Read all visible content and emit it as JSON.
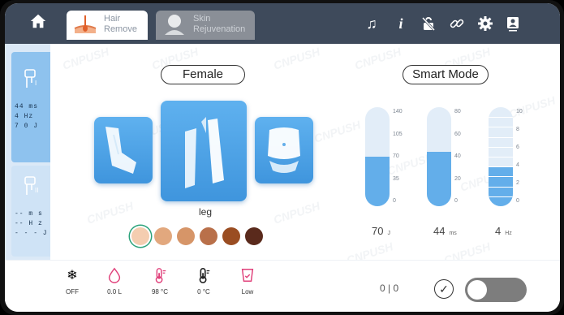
{
  "tabs": [
    {
      "label": "Hair Remove",
      "line1": "Hair",
      "line2": "Remove",
      "active": true
    },
    {
      "label": "Skin Rejuvenation",
      "line1": "Skin",
      "line2": "Rejuvenation",
      "active": false
    }
  ],
  "toolbar_icons": [
    "home-icon",
    "music-icon",
    "info-icon",
    "lock-off-icon",
    "link-icon",
    "gear-icon",
    "user-card-icon"
  ],
  "handpieces": [
    {
      "id": "I",
      "label": "I",
      "line1": "44 ms",
      "line2": "4  Hz",
      "line3": "7 0  J"
    },
    {
      "id": "II",
      "label": "II",
      "line1": "-- m s",
      "line2": "-- H z",
      "line3": "- - -  J"
    }
  ],
  "gender_label": "Female",
  "mode_label": "Smart Mode",
  "body_zones": [
    {
      "name": "arm",
      "selected": false
    },
    {
      "name": "leg",
      "selected": true
    },
    {
      "name": "abdomen",
      "selected": false
    }
  ],
  "selected_zone_label": "leg",
  "skin_tones": {
    "colors": [
      "#f4cdb0",
      "#e2a87e",
      "#d69568",
      "#b9704a",
      "#9a4d22",
      "#5a2a1c"
    ],
    "selected_index": 0
  },
  "gauges": [
    {
      "name": "energy",
      "ticks": [
        "140",
        "105",
        "70",
        "35",
        "0"
      ],
      "max": 140,
      "value": 70,
      "display": "70",
      "unit": "J"
    },
    {
      "name": "pulse-width",
      "ticks": [
        "80",
        "60",
        "40",
        "20",
        "0"
      ],
      "max": 80,
      "value": 44,
      "display": "44",
      "unit": "ms"
    },
    {
      "name": "frequency",
      "ticks": [
        "10",
        "8",
        "6",
        "4",
        "2",
        "0"
      ],
      "max": 10,
      "value": 4,
      "display": "4",
      "unit": "Hz"
    }
  ],
  "status": [
    {
      "icon": "snowflake-icon",
      "label": "OFF"
    },
    {
      "icon": "water-drop-icon",
      "label": "0.0 L"
    },
    {
      "icon": "thermometer-hot-icon",
      "label": "98 °C"
    },
    {
      "icon": "thermometer-icon",
      "label": "0 °C"
    },
    {
      "icon": "water-level-icon",
      "label": "Low"
    }
  ],
  "counter": "0 | 0",
  "ready_toggle": false,
  "watermark": "CNPUSH"
}
